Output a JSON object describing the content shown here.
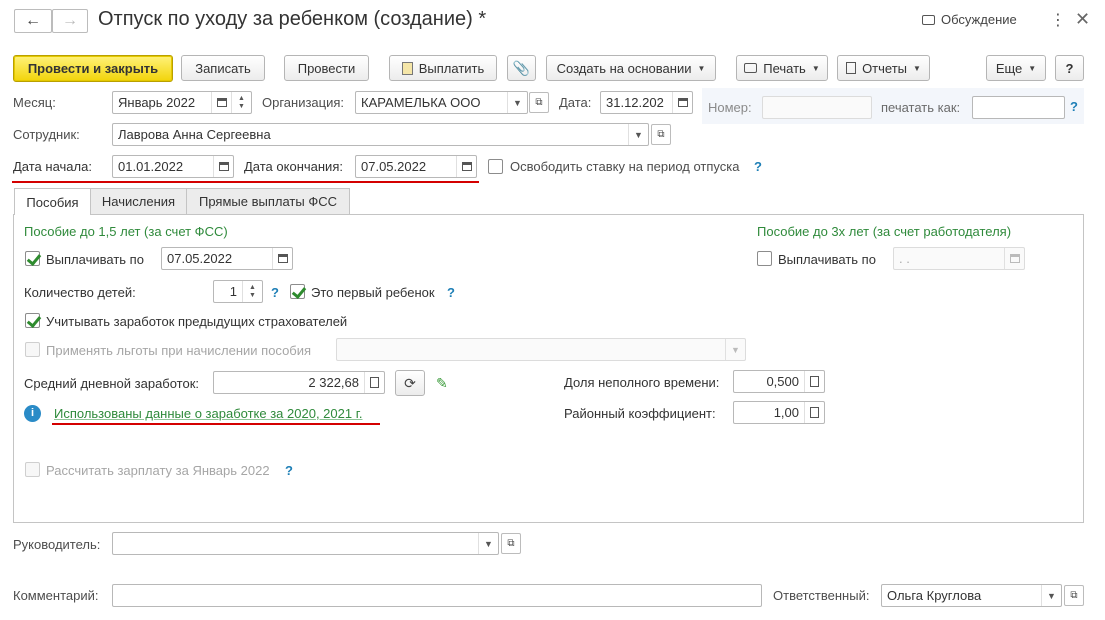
{
  "window": {
    "title": "Отпуск по уходу за ребенком (создание) *",
    "discussion_label": "Обсуждение"
  },
  "toolbar": {
    "post_close": "Провести и закрыть",
    "save": "Записать",
    "post": "Провести",
    "pay": "Выплатить",
    "create_based": "Создать на основании",
    "print": "Печать",
    "reports": "Отчеты",
    "more": "Еще",
    "help": "?"
  },
  "header": {
    "month_label": "Месяц:",
    "month_value": "Январь 2022",
    "org_label": "Организация:",
    "org_value": "КАРАМЕЛЬКА ООО",
    "date_label": "Дата:",
    "date_value": "31.12.202",
    "number_label": "Номер:",
    "number_value": "",
    "print_as_label": "печатать как:",
    "print_as_value": "",
    "employee_label": "Сотрудник:",
    "employee_value": "Лаврова Анна Сергеевна",
    "start_label": "Дата начала:",
    "start_value": "01.01.2022",
    "end_label": "Дата окончания:",
    "end_value": "07.05.2022",
    "release_rate_label": "Освободить ставку на период отпуска"
  },
  "tabs": [
    "Пособия",
    "Начисления",
    "Прямые выплаты ФСС"
  ],
  "benefits": {
    "fss_header": "Пособие до 1,5 лет (за счет ФСС)",
    "employer_header": "Пособие до 3х лет (за счет работодателя)",
    "pay_until_label": "Выплачивать по",
    "pay_until_value": "07.05.2022",
    "pay_until3_label": "Выплачивать по",
    "pay_until3_value": " .  .",
    "children_label": "Количество детей:",
    "children_value": "1",
    "first_child_label": "Это первый ребенок",
    "prev_insurers_label": "Учитывать заработок предыдущих страхователей",
    "apply_benefits_label": "Применять льготы при начислении пособия",
    "avg_earnings_label": "Средний дневной заработок:",
    "avg_earnings_value": "2 322,68",
    "part_time_label": "Доля неполного времени:",
    "part_time_value": "0,500",
    "district_coef_label": "Районный коэффициент:",
    "district_coef_value": "1,00",
    "earnings_info_link": "Использованы данные о заработке за  2020,  2021 г.",
    "calc_salary_label": "Рассчитать зарплату за Январь 2022"
  },
  "footer": {
    "manager_label": "Руководитель:",
    "manager_value": "",
    "comment_label": "Комментарий:",
    "comment_value": "",
    "responsible_label": "Ответственный:",
    "responsible_value": "Ольга Круглова"
  },
  "colors": {
    "accent_yellow": "#f2d40a",
    "green_text": "#2f8a3b",
    "underline_red": "#d40000",
    "help_blue": "#1e7fb6"
  }
}
